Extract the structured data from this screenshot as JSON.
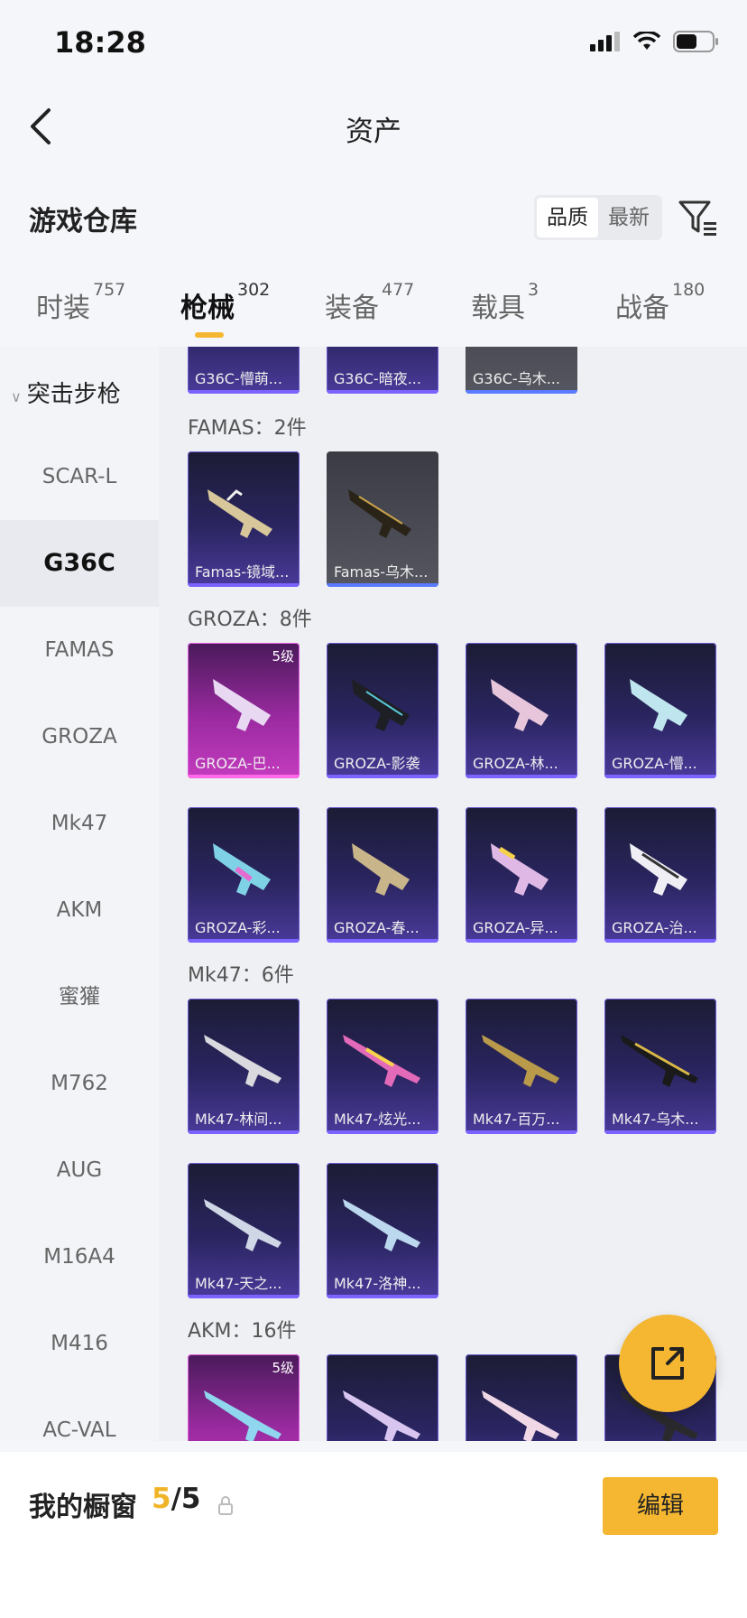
{
  "status": {
    "time": "18:28"
  },
  "nav": {
    "title": "资产"
  },
  "header": {
    "store_title": "游戏仓库",
    "sort_options": [
      "品质",
      "最新"
    ]
  },
  "tabs": [
    {
      "label": "时装",
      "count": "757"
    },
    {
      "label": "枪械",
      "count": "302",
      "active": true
    },
    {
      "label": "装备",
      "count": "477"
    },
    {
      "label": "载具",
      "count": "3"
    },
    {
      "label": "战备",
      "count": "180"
    }
  ],
  "sidebar": {
    "category": "突击步枪",
    "items": [
      "SCAR-L",
      "G36C",
      "FAMAS",
      "GROZA",
      "Mk47",
      "AKM",
      "蜜獾",
      "M762",
      "AUG",
      "M16A4",
      "M416",
      "AC-VAL"
    ],
    "active": "G36C"
  },
  "main": {
    "top_row": [
      "G36C-懵萌...",
      "G36C-暗夜...",
      "G36C-乌木..."
    ],
    "sections": [
      {
        "title": "FAMAS：2件",
        "items": [
          "Famas-镜域...",
          "Famas-乌木..."
        ]
      },
      {
        "title": "GROZA：8件",
        "items": [
          "GROZA-巴...",
          "GROZA-影袭",
          "GROZA-林...",
          "GROZA-懵...",
          "GROZA-彩...",
          "GROZA-春...",
          "GROZA-异...",
          "GROZA-治..."
        ],
        "level": "5级"
      },
      {
        "title": "Mk47：6件",
        "items": [
          "Mk47-林间...",
          "Mk47-炫光...",
          "Mk47-百万...",
          "Mk47-乌木...",
          "Mk47-天之...",
          "Mk47-洛神..."
        ]
      },
      {
        "title": "AKM：16件",
        "level": "5级"
      }
    ]
  },
  "bottom": {
    "label": "我的橱窗",
    "current": "5",
    "total": "/5",
    "edit_label": "编辑"
  },
  "colors": {
    "accent": "#f5b731",
    "card_purple": "#2a2560"
  }
}
